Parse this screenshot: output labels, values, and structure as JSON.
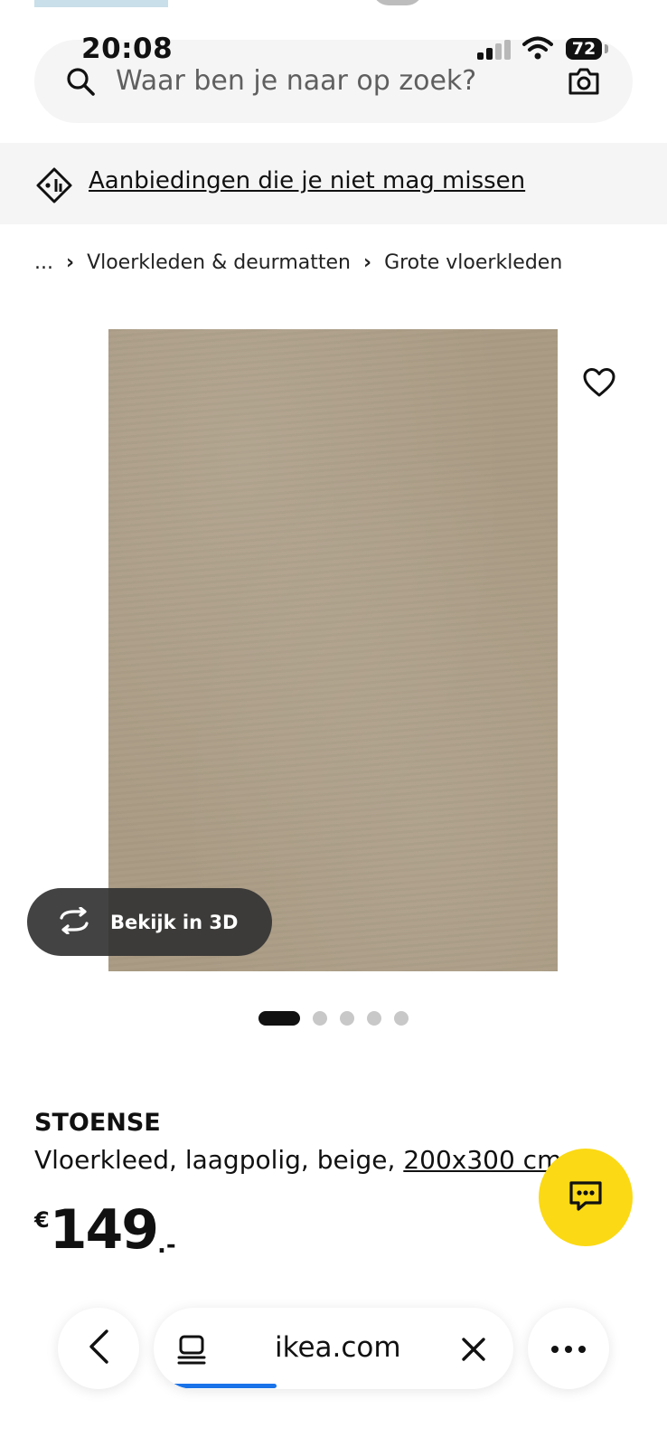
{
  "status_bar": {
    "time": "20:08",
    "battery": "72"
  },
  "search": {
    "placeholder": "Waar ben je naar op zoek?"
  },
  "offers": {
    "label": "Aanbiedingen die je niet mag missen"
  },
  "breadcrumb": {
    "items": [
      "...",
      "Vloerkleden & deurmatten",
      "Grote vloerkleden"
    ]
  },
  "gallery": {
    "view_3d_label": "Bekijk in 3D",
    "image_count": 5,
    "active_index": 0
  },
  "product": {
    "name": "STOENSE",
    "description": "Vloerkleed, laagpolig, beige, ",
    "size": "200x300 cm",
    "price_currency": "€",
    "price_main": "149",
    "price_suffix": ".-"
  },
  "browser": {
    "url": "ikea.com"
  },
  "colors": {
    "accent_yellow": "#fbd914",
    "progress_blue": "#1a73e8",
    "rug_beige": "#a99a83"
  },
  "icons": [
    "search-icon",
    "camera-icon",
    "tag-icon",
    "heart-icon",
    "rotate-3d-icon",
    "chat-icon",
    "chevron-left-icon",
    "tabs-icon",
    "close-icon",
    "more-icon"
  ]
}
